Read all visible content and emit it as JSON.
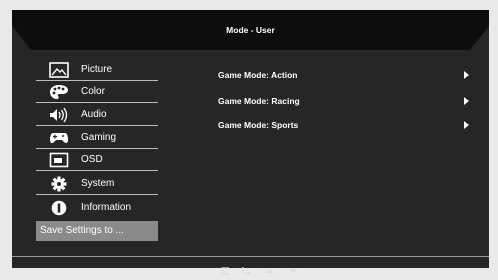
{
  "header": {
    "title": "Mode - User"
  },
  "menu": [
    {
      "label": "Picture",
      "icon": "picture-icon"
    },
    {
      "label": "Color",
      "icon": "palette-icon"
    },
    {
      "label": "Audio",
      "icon": "speaker-icon"
    },
    {
      "label": "Gaming",
      "icon": "gamepad-icon"
    },
    {
      "label": "OSD",
      "icon": "osd-icon"
    },
    {
      "label": "System",
      "icon": "gear-icon"
    },
    {
      "label": "Information",
      "icon": "info-icon"
    }
  ],
  "save_label": "Save Settings to ...",
  "options": [
    {
      "label": "Game Mode: Action"
    },
    {
      "label": "Game Mode: Racing"
    },
    {
      "label": "Game Mode: Sports"
    }
  ],
  "nav_icons": [
    "back-icon",
    "enter-icon",
    "up-icon",
    "down-icon"
  ],
  "colors": {
    "panel": "#262626",
    "header": "#0d0d0d",
    "selected": "#8a8a8a",
    "text": "#ffffff"
  }
}
